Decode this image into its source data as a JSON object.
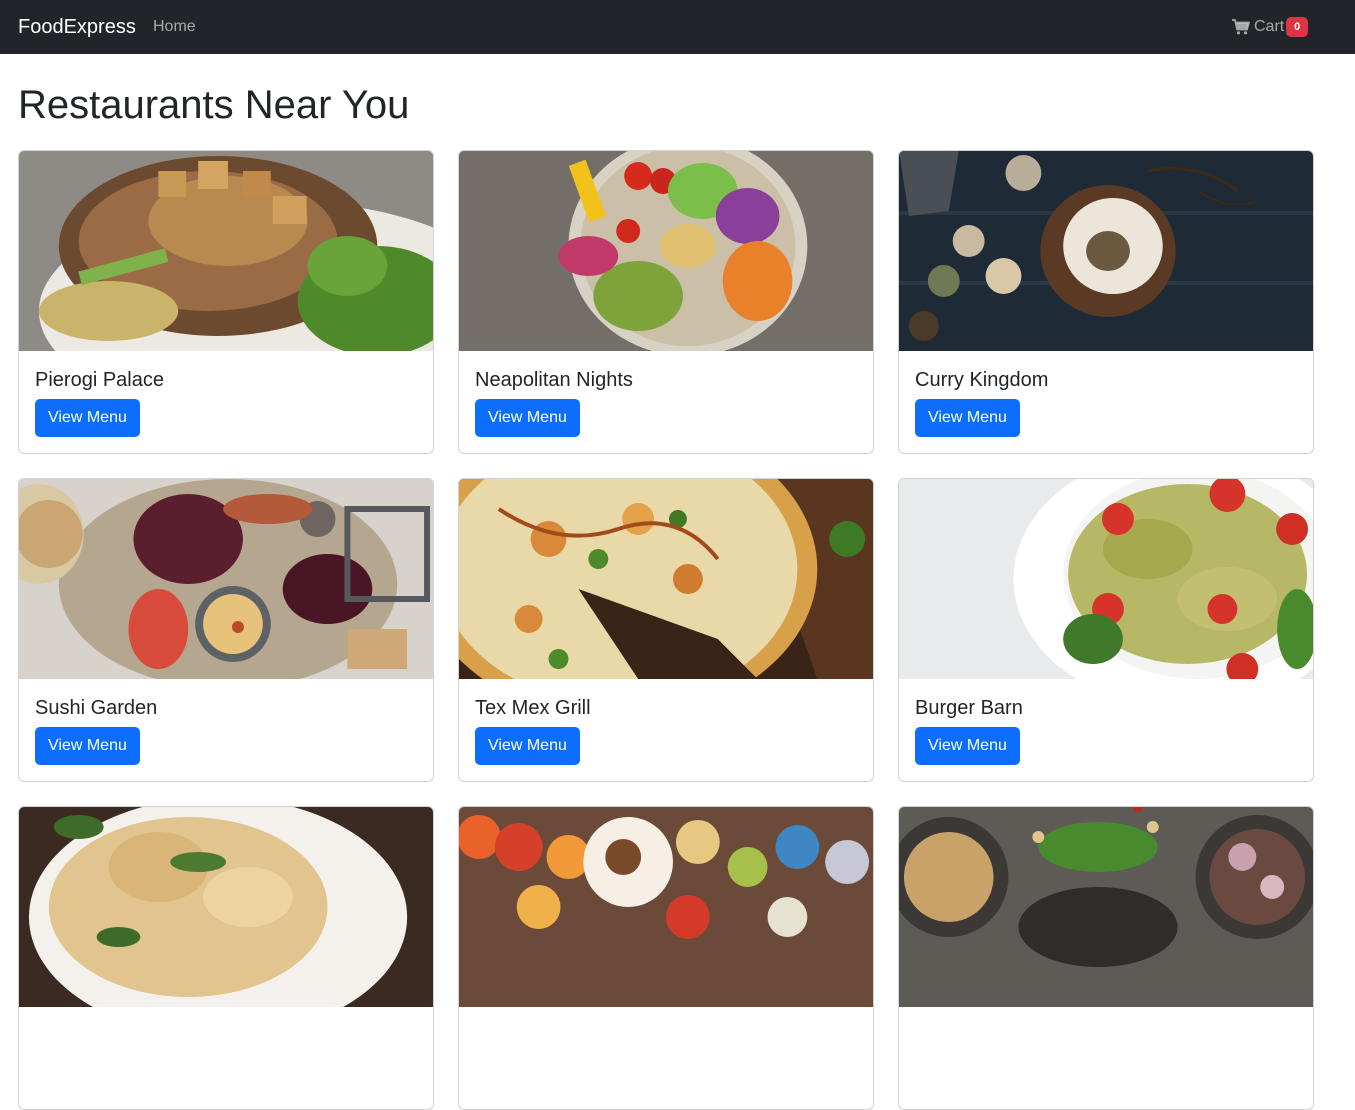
{
  "navbar": {
    "brand": "FoodExpress",
    "links": [
      {
        "label": "Home"
      }
    ],
    "cart": {
      "label": "Cart",
      "count": "0",
      "icon": "cart-icon"
    }
  },
  "page": {
    "title": "Restaurants Near You"
  },
  "colors": {
    "navbar_bg": "#212529",
    "primary_button": "#0d6efd",
    "badge": "#dc3545"
  },
  "restaurants": [
    {
      "name": "Pierogi Palace",
      "button": "View Menu",
      "image": "grilled-pork-chop-with-broccolini"
    },
    {
      "name": "Neapolitan Nights",
      "button": "View Menu",
      "image": "vegetable-bowl-with-avocado-and-chickpeas"
    },
    {
      "name": "Curry Kingdom",
      "button": "View Menu",
      "image": "dessert-on-dark-table-with-spices"
    },
    {
      "name": "Sushi Garden",
      "button": "View Menu",
      "image": "charcuterie-board-with-grapes-and-dip"
    },
    {
      "name": "Tex Mex Grill",
      "button": "View Menu",
      "image": "sliced-pizza-on-wooden-board"
    },
    {
      "name": "Burger Barn",
      "button": "View Menu",
      "image": "pesto-farfalle-with-tomatoes"
    },
    {
      "name": "",
      "button": "",
      "image": "pasta-dish-with-parmesan"
    },
    {
      "name": "",
      "button": "",
      "image": "assorted-fruits-and-pastries"
    },
    {
      "name": "",
      "button": "",
      "image": "bowls-with-salads-and-cashews"
    }
  ]
}
